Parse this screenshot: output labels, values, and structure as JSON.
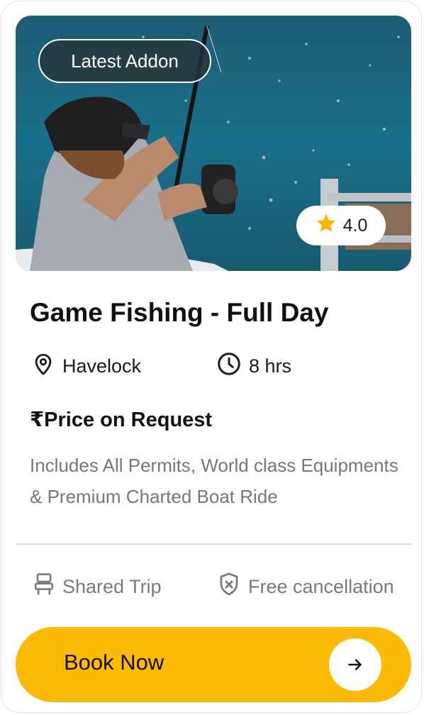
{
  "card": {
    "badge": "Latest Addon",
    "rating": "4.0",
    "title": "Game Fishing - Full Day",
    "location": "Havelock",
    "duration": "8 hrs",
    "price": "₹Price on Request",
    "description": "Includes All Permits, World class Equipments & Premium Charted Boat Ride",
    "features": {
      "shared": "Shared Trip",
      "cancellation": "Free cancellation"
    },
    "cta": "Book Now"
  },
  "icons": {
    "rating": "star-icon",
    "location": "map-pin-icon",
    "duration": "clock-icon",
    "shared": "seat-icon",
    "cancellation": "shield-x-icon",
    "cta": "arrow-right-icon"
  },
  "colors": {
    "accent": "#fdba05",
    "star": "#f7b500",
    "badge_bg": "#26343a",
    "muted_text": "#777777"
  }
}
